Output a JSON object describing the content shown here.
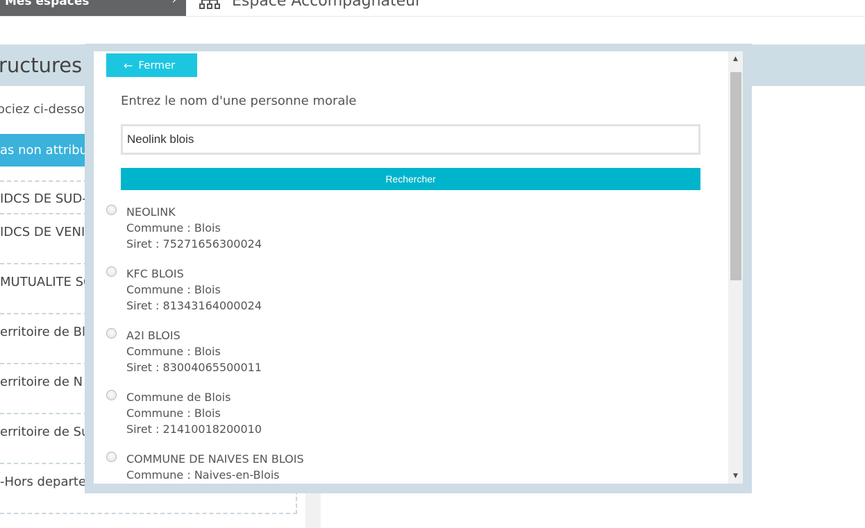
{
  "header": {
    "mes_espaces": "Mes espaces",
    "espace_title": "Espace Accompagnateur"
  },
  "background": {
    "structures_title": "ructures",
    "associez_text": "ociez ci-desso",
    "non_attribues": "as non attribu",
    "structures": [
      "IDCS DE SUD-",
      "IDCS DE VENI",
      "MUTUALITE SC",
      "erritoire de Bl",
      "erritoire de N",
      "erritoire de Su",
      "-Hors departement"
    ]
  },
  "modal": {
    "close_label": "Fermer",
    "prompt": "Entrez le nom d'une personne morale",
    "search_value": "Neolink blois",
    "search_button": "Rechercher",
    "results": [
      {
        "name": "NEOLINK",
        "commune": "Commune : Blois",
        "siret": "Siret : 75271656300024"
      },
      {
        "name": "KFC BLOIS",
        "commune": "Commune : Blois",
        "siret": "Siret : 81343164000024"
      },
      {
        "name": "A2I BLOIS",
        "commune": "Commune : Blois",
        "siret": "Siret : 83004065500011"
      },
      {
        "name": "Commune de Blois",
        "commune": "Commune : Blois",
        "siret": "Siret : 21410018200010"
      },
      {
        "name": "COMMUNE DE NAIVES EN BLOIS",
        "commune": "Commune : Naives-en-Blois",
        "siret": ""
      }
    ]
  },
  "colors": {
    "accent": "#1cc6e0",
    "button": "#00b5cb",
    "band": "#cddde6"
  }
}
